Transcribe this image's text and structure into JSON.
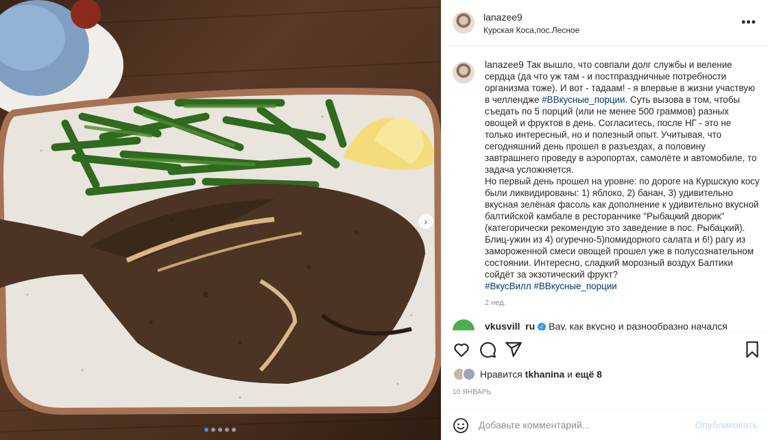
{
  "header": {
    "username": "lanazee9",
    "location": "Курская Коса,пос.Лесное",
    "more_icon": "more-options-icon"
  },
  "caption": {
    "username": "lanazee9",
    "text_before_tag": "Так вышло, что совпали долг службы и веление сердца (да что уж там - и постпраздничные потребности организма тоже). И вот - тадаам! - я впервые в жизни участвую в челлендже ",
    "tag1": "#ВВкусные_порции",
    "text_after_tag": ". Суть вызова в том, чтобы съедать по 5 порций (или не менее 500 граммов) разных овощей и фруктов в день. Согласитесь, после НГ - это не только интересный, но и полезный опыт. Учитывая, что сегодняшний день прошел в разъездах, а половину завтрашнего проведу в аэропортах, самолёте и автомобиле, то задача усложняется.",
    "text_para2": "Но первый день прошел на уровне: по дороге на Куршскую косу были ликвидированы: 1) яблоко, 2) банан, 3) удивительно вкусная зелёная фасоль как дополнение к удивительно вкусной балтийской камбале в ресторанчике \"Рыбацкий дворик\" (категорически рекомендую это заведение в пос. Рыбацкий). Блиц-ужин из 4) огуречно-5)помидорного салата и 6!) рагу из замороженной смеси овощей прошел уже в полусознательном состоянии. Интересно, сладкий морозный воздух Балтики сойдёт за экзотический фрукт?",
    "tag2": "#ВкусВилл",
    "tag3": "#ВВкусные_порции",
    "time_ago": "2 нед."
  },
  "comment": {
    "username": "vkusvill_ru",
    "text": "Вау, как вкусно и разнообразно начался"
  },
  "actions": {
    "like_icon": "heart-icon",
    "comment_icon": "comment-icon",
    "share_icon": "share-icon",
    "save_icon": "bookmark-icon"
  },
  "likes": {
    "prefix": "Нравится",
    "user": "tkhanina",
    "conjunction": "и",
    "others": "ещё 8"
  },
  "date": "10 ЯНВАРЬ",
  "add_comment": {
    "placeholder": "Добавьте комментарий...",
    "publish_label": "Опубликовать"
  },
  "carousel": {
    "total": 5,
    "active_index": 0
  },
  "colors": {
    "link": "#00376b",
    "accent": "#3897f0",
    "publish_disabled": "#b2dffc",
    "muted": "#8e8e8e"
  }
}
